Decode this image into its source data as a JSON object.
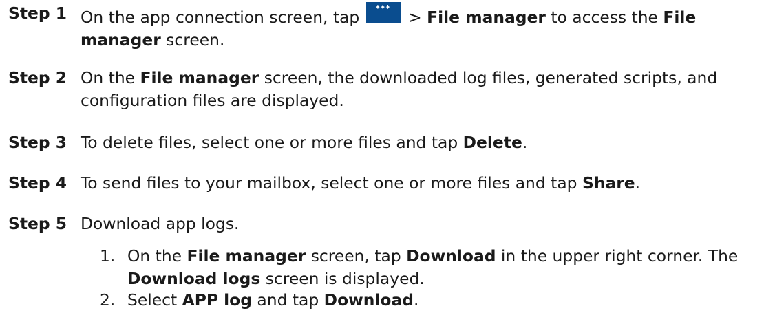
{
  "steps": [
    {
      "label": "Step 1",
      "parts": [
        "On the app connection screen, tap ",
        " > ",
        "File manager",
        " to access the ",
        "File manager",
        " screen."
      ]
    },
    {
      "label": "Step 2",
      "parts": [
        "On the ",
        "File manager",
        " screen, the downloaded log files, generated scripts, and configuration files are displayed."
      ]
    },
    {
      "label": "Step 3",
      "parts": [
        "To delete files, select one or more files and tap ",
        "Delete",
        "."
      ]
    },
    {
      "label": "Step 4",
      "parts": [
        "To send files to your mailbox, select one or more files and tap ",
        "Share",
        "."
      ]
    },
    {
      "label": "Step 5",
      "parts": [
        "Download app logs."
      ]
    }
  ],
  "icon": {
    "name": "more-icon",
    "glyph": "***",
    "color": "#0a4d8f"
  },
  "substeps": [
    {
      "num": "1.",
      "parts": [
        "On the ",
        "File manager",
        " screen, tap ",
        "Download",
        " in the upper right corner. The ",
        "Download logs",
        " screen is displayed."
      ]
    },
    {
      "num": "2.",
      "parts": [
        "Select ",
        "APP log",
        " and tap ",
        "Download",
        "."
      ]
    }
  ]
}
